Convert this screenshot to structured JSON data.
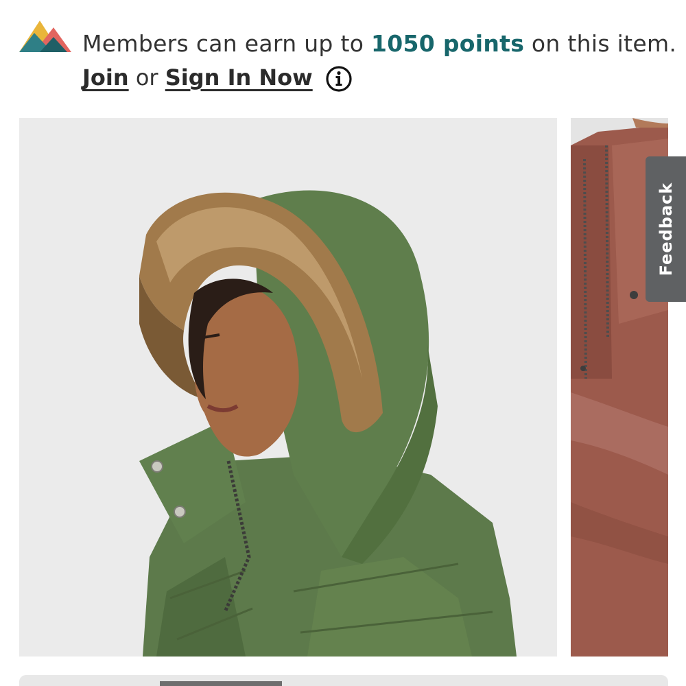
{
  "rewards": {
    "logo_icon": "mountain-peaks-logo",
    "prefix": "Members can earn up to ",
    "points": "1050 points",
    "suffix": " on this item.",
    "join_label": "Join",
    "or_text": " or ",
    "signin_label": "Sign In Now",
    "info_icon": "info-circle-icon",
    "colors": {
      "points": "#17666b",
      "text": "#333333"
    }
  },
  "gallery": {
    "main_image": "green-parka-with-fur-trim-hood",
    "next_image": "mauve-quilted-jacket"
  },
  "feedback": {
    "label": "Feedback",
    "color": "#5f6163"
  }
}
